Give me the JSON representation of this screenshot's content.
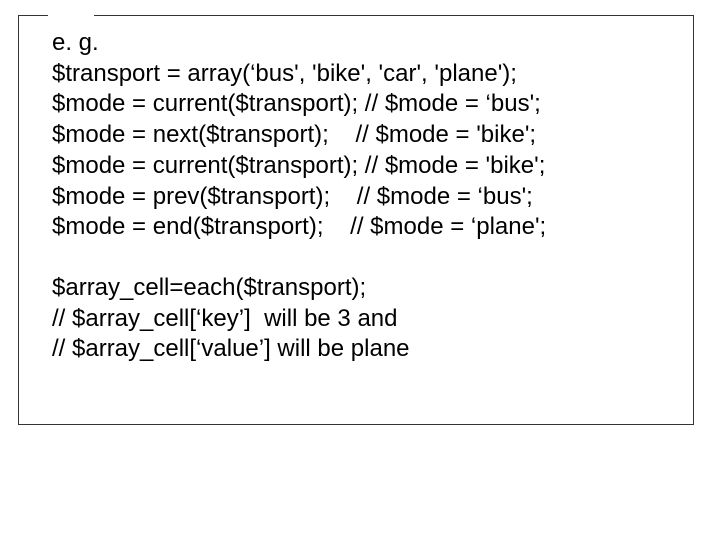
{
  "code": {
    "l1": "e. g.",
    "l2": "$transport = array(‘bus', 'bike', 'car', 'plane');",
    "l3": "$mode = current($transport); // $mode = ‘bus';",
    "l4": "$mode = next($transport);    // $mode = 'bike';",
    "l5": "$mode = current($transport); // $mode = 'bike';",
    "l6": "$mode = prev($transport);    // $mode = ‘bus';",
    "l7": "$mode = end($transport);    // $mode = ‘plane';",
    "l8": "$array_cell=each($transport);",
    "l9": "// $array_cell[‘key’]  will be 3 and",
    "l10": "// $array_cell[‘value’] will be plane"
  }
}
